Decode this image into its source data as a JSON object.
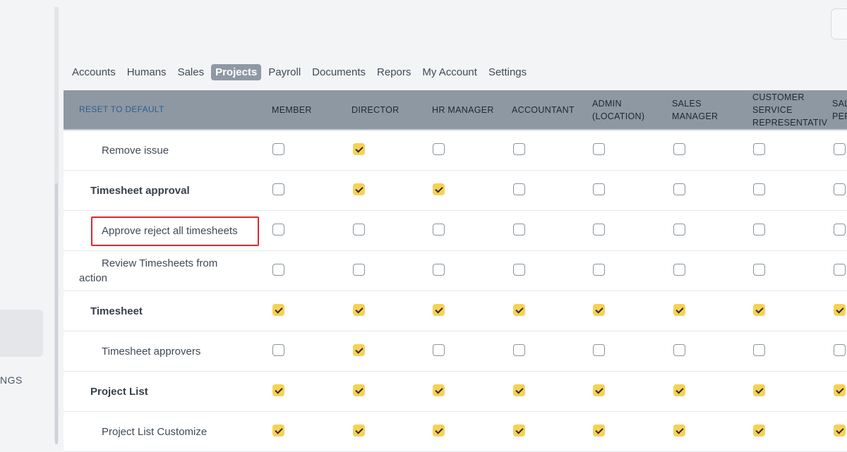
{
  "sidebar": {
    "label": "NGS"
  },
  "tabs": [
    {
      "label": "Accounts",
      "active": false
    },
    {
      "label": "Humans",
      "active": false
    },
    {
      "label": "Sales",
      "active": false
    },
    {
      "label": "Projects",
      "active": true
    },
    {
      "label": "Payroll",
      "active": false
    },
    {
      "label": "Documents",
      "active": false
    },
    {
      "label": "Repors",
      "active": false
    },
    {
      "label": "My Account",
      "active": false
    },
    {
      "label": "Settings",
      "active": false
    }
  ],
  "table": {
    "reset_label": "RESET TO DEFAULT",
    "columns": [
      "MEMBER",
      "DIRECTOR",
      "HR MANAGER",
      "ACCOUNTANT",
      "ADMIN\n(LOCATION)",
      "SALES\nMANAGER",
      "CUSTOMER\nSERVICE\nREPRESENTATIV",
      "SAL\nPER"
    ],
    "rows": [
      {
        "label": "Remove issue",
        "type": "child",
        "checks": [
          false,
          true,
          false,
          false,
          false,
          false,
          false,
          false
        ]
      },
      {
        "label": "Timesheet approval",
        "type": "group",
        "checks": [
          false,
          true,
          true,
          false,
          false,
          false,
          false,
          false
        ]
      },
      {
        "label": "Approve reject all timesheets",
        "type": "child",
        "checks": [
          false,
          false,
          false,
          false,
          false,
          false,
          false,
          false
        ]
      },
      {
        "label": "Review Timesheets from\naction",
        "type": "child-wrap",
        "checks": [
          false,
          false,
          false,
          false,
          false,
          false,
          false,
          false
        ]
      },
      {
        "label": "Timesheet",
        "type": "group",
        "checks": [
          true,
          true,
          true,
          true,
          true,
          true,
          true,
          true
        ]
      },
      {
        "label": "Timesheet approvers",
        "type": "child",
        "checks": [
          false,
          true,
          false,
          false,
          false,
          false,
          false,
          false
        ]
      },
      {
        "label": "Project List",
        "type": "group",
        "checks": [
          true,
          true,
          true,
          true,
          true,
          true,
          true,
          true
        ]
      },
      {
        "label": "Project List Customize",
        "type": "child",
        "checks": [
          true,
          true,
          true,
          true,
          true,
          true,
          true,
          true
        ]
      }
    ]
  },
  "colors": {
    "accent": "#f7d154",
    "header_bg": "#8e98a3",
    "highlight": "#e0262b",
    "active_tab": "#8f99a4"
  }
}
